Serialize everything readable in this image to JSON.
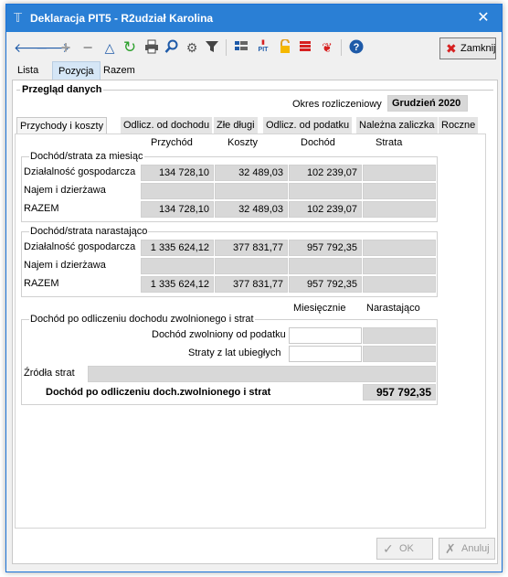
{
  "window": {
    "title": "Deklaracja PIT5 - R2udział Karolina",
    "close_glyph": "✕"
  },
  "toolbar": {
    "icons": [
      "arrow-left-icon",
      "arrow-right-icon",
      "plus-icon",
      "minus-icon",
      "delta-icon",
      "refresh-icon",
      "print-icon",
      "search-icon",
      "settings-icon",
      "filter-icon",
      "grid-icon",
      "pit-icon",
      "lock-icon",
      "stack-icon",
      "ribbon-icon",
      "help-icon"
    ],
    "close_label": "Zamknij"
  },
  "main_tabs": [
    "Lista",
    "Pozycja",
    "Razem"
  ],
  "panel": {
    "title": "Przegląd danych",
    "period_label": "Okres rozliczeniowy",
    "period_value": "Grudzień 2020"
  },
  "sub_tabs": [
    "Przychody i koszty",
    "Odlicz. od dochodu",
    "Złe długi",
    "Odlicz. od podatku",
    "Należna zaliczka",
    "Roczne"
  ],
  "columns": [
    "Przychód",
    "Koszty",
    "Dochód",
    "Strata"
  ],
  "monthly": {
    "title": "Dochód/strata za miesiąc",
    "rows": [
      {
        "label": "Działalność gospodarcza",
        "values": [
          "134 728,10",
          "32 489,03",
          "102 239,07",
          ""
        ]
      },
      {
        "label": "Najem i dzierżawa",
        "values": [
          "",
          "",
          "",
          ""
        ]
      },
      {
        "label": "RAZEM",
        "values": [
          "134 728,10",
          "32 489,03",
          "102 239,07",
          ""
        ]
      }
    ]
  },
  "cumulative": {
    "title": "Dochód/strata narastająco",
    "rows": [
      {
        "label": "Działalność gospodarcza",
        "values": [
          "1 335 624,12",
          "377 831,77",
          "957 792,35",
          ""
        ]
      },
      {
        "label": "Najem i dzierżawa",
        "values": [
          "",
          "",
          "",
          ""
        ]
      },
      {
        "label": "RAZEM",
        "values": [
          "1 335 624,12",
          "377 831,77",
          "957 792,35",
          ""
        ]
      }
    ]
  },
  "after_deduction": {
    "col_monthly": "Miesięcznie",
    "col_cumulative": "Narastająco",
    "title": "Dochód po odliczeniu dochodu zwolnionego i strat",
    "exempt_label": "Dochód zwolniony od podatku",
    "losses_label": "Straty z lat ubiegłych",
    "sources_label": "Źródła strat",
    "total_label": "Dochód po odliczeniu doch.zwolnionego i strat",
    "total_value": "957 792,35"
  },
  "buttons": {
    "ok": "OK",
    "cancel": "Anuluj"
  }
}
